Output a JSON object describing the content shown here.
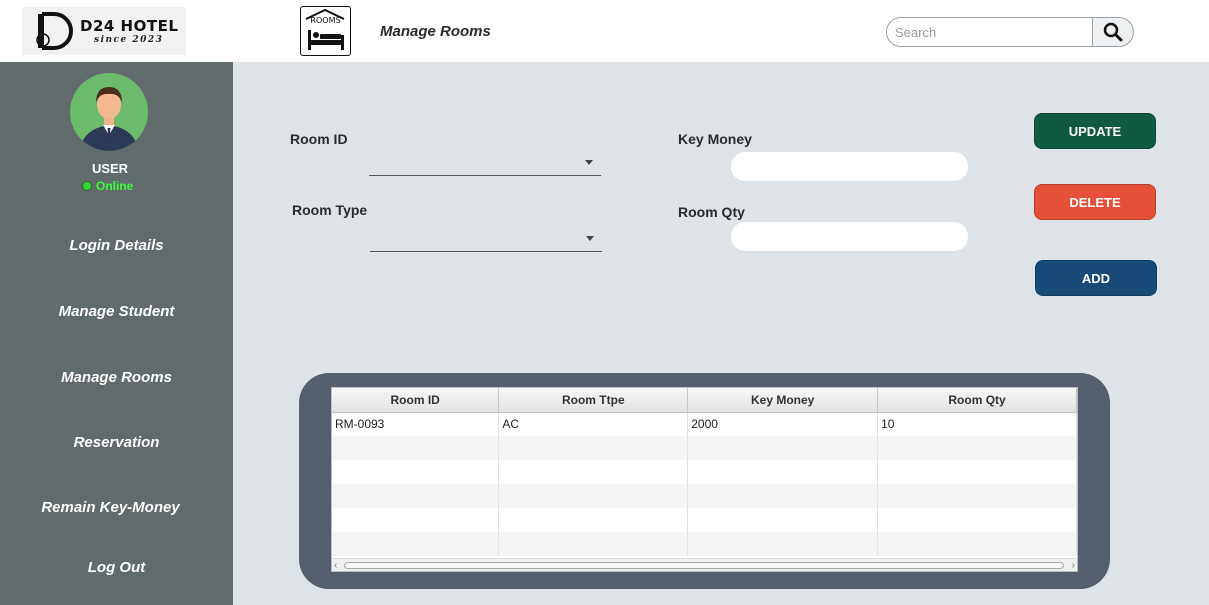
{
  "header": {
    "logo_name": "D24 HOTEL",
    "logo_sub": "since 2023",
    "rooms_icon_text": "ROOMS",
    "page_title": "Manage Rooms",
    "search_placeholder": "Search"
  },
  "sidebar": {
    "user": "USER",
    "status": "Online",
    "items": [
      {
        "label": "Login Details"
      },
      {
        "label": "Manage Student"
      },
      {
        "label": "Manage Rooms"
      },
      {
        "label": "Reservation"
      },
      {
        "label": "Remain Key-Money"
      },
      {
        "label": "Log Out"
      }
    ]
  },
  "form": {
    "room_id_label": "Room ID",
    "room_type_label": "Room Type",
    "key_money_label": "Key Money",
    "room_qty_label": "Room Qty",
    "room_id_value": "",
    "room_type_value": "",
    "key_money_value": "",
    "room_qty_value": ""
  },
  "buttons": {
    "update": "UPDATE",
    "delete": "DELETE",
    "add": "ADD"
  },
  "colors": {
    "update": "#0f5a41",
    "delete": "#e55039",
    "add": "#184a78",
    "sidebar": "#616b6c",
    "main_bg": "#dde3e6",
    "table_panel": "#545e6d"
  },
  "table": {
    "columns": [
      "Room ID",
      "Room Ttpe",
      "Key Money",
      "Room Qty"
    ],
    "rows": [
      [
        "RM-0093",
        "AC",
        "2000",
        "10"
      ]
    ]
  }
}
